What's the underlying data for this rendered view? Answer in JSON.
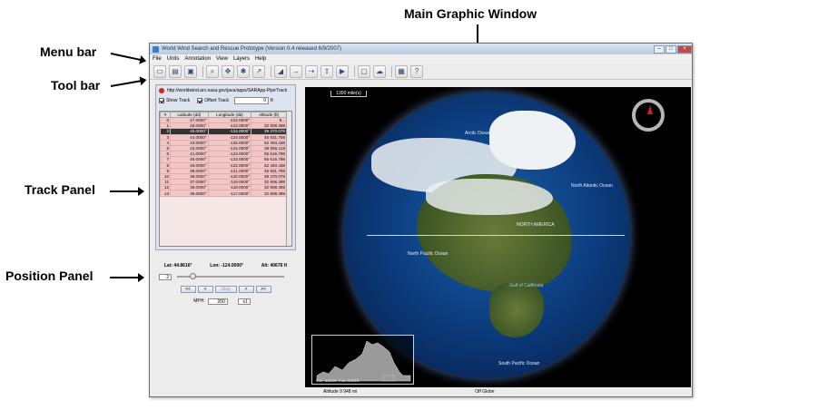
{
  "callouts": {
    "main_graphic_window": "Main Graphic Window",
    "menu_bar": "Menu bar",
    "tool_bar": "Tool bar",
    "track_panel": "Track Panel",
    "position_panel": "Position Panel"
  },
  "window": {
    "title": "World Wind Search and Rescue Prototype (Version 0.4 released 6/9/2007)"
  },
  "menu": [
    "File",
    "Units",
    "Annotation",
    "View",
    "Layers",
    "Help"
  ],
  "track_panel": {
    "url": "http://worldwind.arc.nasa.gov/java/apps/SARApp-PipeTrack",
    "show_track_label": "Show Track",
    "offset_track_label": "Offset Track",
    "offset_value": "0",
    "offset_unit": "ft",
    "columns": [
      "#",
      "Latitude (dd)",
      "Longitude (dd)",
      "Altitude (ft)"
    ],
    "rows": [
      [
        "0",
        "47.0000°",
        "-122.0000°",
        "9..."
      ],
      [
        "1",
        "46.0000°",
        "-123.0000°",
        "32 808.399"
      ],
      [
        "2",
        "45.0000°",
        "-124.0000°",
        "39 370.079"
      ],
      [
        "3",
        "44.0000°",
        "-124.0000°",
        "45 931.759"
      ],
      [
        "4",
        "43.0000°",
        "-125.0000°",
        "52 493.438"
      ],
      [
        "5",
        "42.0000°",
        "-124.0000°",
        "59 055.118"
      ],
      [
        "6",
        "41.0000°",
        "-124.0000°",
        "65 616.798"
      ],
      [
        "7",
        "40.0000°",
        "-123.0000°",
        "65 616.798"
      ],
      [
        "8",
        "40.0000°",
        "-122.0000°",
        "52 493.438"
      ],
      [
        "9",
        "39.0000°",
        "-121.0000°",
        "45 931.759"
      ],
      [
        "10",
        "38.0000°",
        "-120.0000°",
        "39 370.079"
      ],
      [
        "11",
        "37.0000°",
        "-119.0000°",
        "32 808.399"
      ],
      [
        "12",
        "36.0000°",
        "-118.0000°",
        "32 808.399"
      ],
      [
        "13",
        "36.0000°",
        "-117.0000°",
        "32 808.399"
      ]
    ],
    "selected_row": 2
  },
  "position_panel": {
    "lat": "Lat: 44.8616°",
    "lon": "Lon: -124.0000°",
    "alt": "Alt: 40676 ft",
    "segment_value": "2",
    "slider_position": 0.12,
    "buttons": [
      "<<",
      "<",
      "Stop",
      ">",
      ">>"
    ],
    "mph_label": "MPH:",
    "mph_value": "200",
    "speed_multiplier": "x1"
  },
  "globe": {
    "scale_label": "1300 mile(s)",
    "labels": {
      "arctic": "Arctic Ocean",
      "north_atlantic": "North Atlantic Ocean",
      "north_america": "NORTH AMERICA",
      "north_pacific": "North Pacific Ocean",
      "gulf": "Gulf of California",
      "south_pacific": "South Pacific Ocean"
    },
    "profile_min": "min -10568",
    "profile_max": "max 9001ft"
  },
  "status": {
    "altitude": "Altitude   9 948 mi",
    "off_globe": "Off Globe"
  },
  "colors": {
    "track_line": "#e8e84a",
    "table_row": "#f4c6c6",
    "record_dot": "#e02020"
  }
}
